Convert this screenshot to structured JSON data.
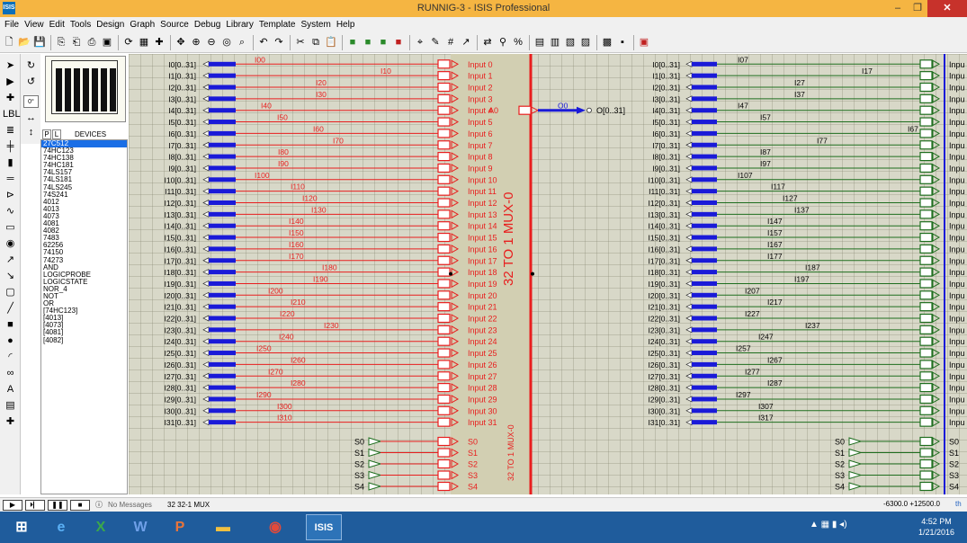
{
  "window": {
    "title": "RUNNIG-3 - ISIS Professional",
    "app_icon": "ISIS",
    "minimize": "–",
    "maximize": "❐",
    "close": "✕"
  },
  "menu": [
    "File",
    "View",
    "Edit",
    "Tools",
    "Design",
    "Graph",
    "Source",
    "Debug",
    "Library",
    "Template",
    "System",
    "Help"
  ],
  "device_panel": {
    "tab_p": "P",
    "tab_l": "L",
    "title": "DEVICES",
    "selected": "27C512",
    "items": [
      "27C512",
      "74HC123",
      "74HC138",
      "74HC181",
      "74LS157",
      "74LS181",
      "74LS245",
      "74S241",
      "4012",
      "4013",
      "4073",
      "4081",
      "4082",
      "7483",
      "62256",
      "74150",
      "74273",
      "AND",
      "LOGICPROBE",
      "LOGICSTATE",
      "NOR_4",
      "NOT",
      "OR",
      "[74HC123]",
      "[4013]",
      "[4073]",
      "[4081]",
      "[4082]"
    ]
  },
  "schematic": {
    "mux_label": "32 TO 1 MUX-0",
    "mux_label_small": "32 TO 1 MUX-0",
    "output_pin": "A0",
    "output_net": "O0",
    "output_bus": "O[0..31]",
    "left": {
      "buses": [
        "I0[0..31]",
        "I1[0..31]",
        "I2[0..31]",
        "I3[0..31]",
        "I4[0..31]",
        "I5[0..31]",
        "I6[0..31]",
        "I7[0..31]",
        "I8[0..31]",
        "I9[0..31]",
        "I10[0..31]",
        "I11[0..31]",
        "I12[0..31]",
        "I13[0..31]",
        "I14[0..31]",
        "I15[0..31]",
        "I16[0..31]",
        "I17[0..31]",
        "I18[0..31]",
        "I19[0..31]",
        "I20[0..31]",
        "I21[0..31]",
        "I22[0..31]",
        "I23[0..31]",
        "I24[0..31]",
        "I25[0..31]",
        "I26[0..31]",
        "I27[0..31]",
        "I28[0..31]",
        "I29[0..31]",
        "I30[0..31]",
        "I31[0..31]"
      ],
      "nets": [
        "I00",
        "I10",
        "I20",
        "I30",
        "I40",
        "I50",
        "I60",
        "I70",
        "I80",
        "I90",
        "I100",
        "I110",
        "I120",
        "I130",
        "I140",
        "I150",
        "I160",
        "I170",
        "I180",
        "I190",
        "I200",
        "I210",
        "I220",
        "I230",
        "I240",
        "I250",
        "I260",
        "I270",
        "I280",
        "I290",
        "I300",
        "I310"
      ],
      "inputs": [
        "Input 0",
        "Input 1",
        "Input 2",
        "Input 3",
        "Input 4",
        "Input 5",
        "Input 6",
        "Input 7",
        "Input 8",
        "Input 9",
        "Input 10",
        "Input 11",
        "Input 12",
        "Input 13",
        "Input 14",
        "Input 15",
        "Input 16",
        "Input 17",
        "Input 18",
        "Input 19",
        "Input 20",
        "Input 21",
        "Input 22",
        "Input 23",
        "Input 24",
        "Input 25",
        "Input 26",
        "Input 27",
        "Input 28",
        "Input 29",
        "Input 30",
        "Input 31"
      ],
      "sel_terms": [
        "S0",
        "S1",
        "S2",
        "S3",
        "S4"
      ],
      "sel_pins": [
        "S0",
        "S1",
        "S2",
        "S3",
        "S4"
      ]
    },
    "right": {
      "buses": [
        "I0[0..31]",
        "I1[0..31]",
        "I2[0..31]",
        "I3[0..31]",
        "I4[0..31]",
        "I5[0..31]",
        "I6[0..31]",
        "I7[0..31]",
        "I8[0..31]",
        "I9[0..31]",
        "I10[0..31]",
        "I11[0..31]",
        "I12[0..31]",
        "I13[0..31]",
        "I14[0..31]",
        "I15[0..31]",
        "I16[0..31]",
        "I17[0..31]",
        "I18[0..31]",
        "I19[0..31]",
        "I20[0..31]",
        "I21[0..31]",
        "I22[0..31]",
        "I23[0..31]",
        "I24[0..31]",
        "I25[0..31]",
        "I26[0..31]",
        "I27[0..31]",
        "I28[0..31]",
        "I29[0..31]",
        "I30[0..31]",
        "I31[0..31]"
      ],
      "nets": [
        "I07",
        "I17",
        "I27",
        "I37",
        "I47",
        "I57",
        "I67",
        "I77",
        "I87",
        "I97",
        "I107",
        "I117",
        "I127",
        "I137",
        "I147",
        "I157",
        "I167",
        "I177",
        "I187",
        "I197",
        "I207",
        "I217",
        "I227",
        "I237",
        "I247",
        "I257",
        "I267",
        "I277",
        "I287",
        "I297",
        "I307",
        "I317"
      ],
      "inputs_label": "Inpu",
      "sel_terms": [
        "S0",
        "S1",
        "S2",
        "S3",
        "S4"
      ],
      "sel_pins": [
        "S0",
        "S1",
        "S2",
        "S3",
        "S4"
      ]
    }
  },
  "status": {
    "messages": "No Messages",
    "sheet": "32 32-1 MUX",
    "coords": "-6300.0 +12500.0",
    "units": "th"
  },
  "taskbar": {
    "isis_label": "ISIS",
    "time": "4:52 PM",
    "date": "1/21/2016"
  }
}
